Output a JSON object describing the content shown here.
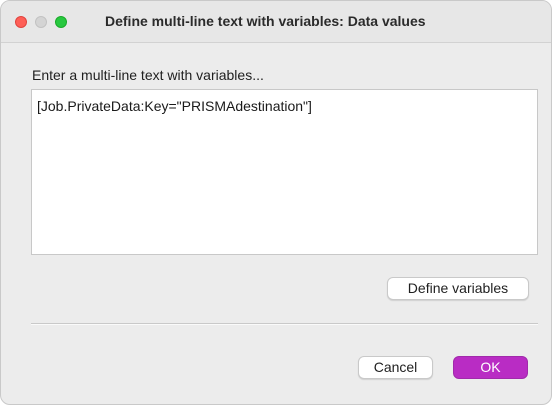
{
  "window": {
    "title": "Define multi-line text with variables: Data values"
  },
  "dialog": {
    "prompt": "Enter a multi-line text with variables...",
    "text_value": "[Job.PrivateData:Key=\"PRISMAdestination\"]",
    "define_variables_label": "Define variables",
    "cancel_label": "Cancel",
    "ok_label": "OK"
  },
  "colors": {
    "accent": "#b92cc4",
    "close": "#fe5f57",
    "zoom": "#28c840"
  }
}
